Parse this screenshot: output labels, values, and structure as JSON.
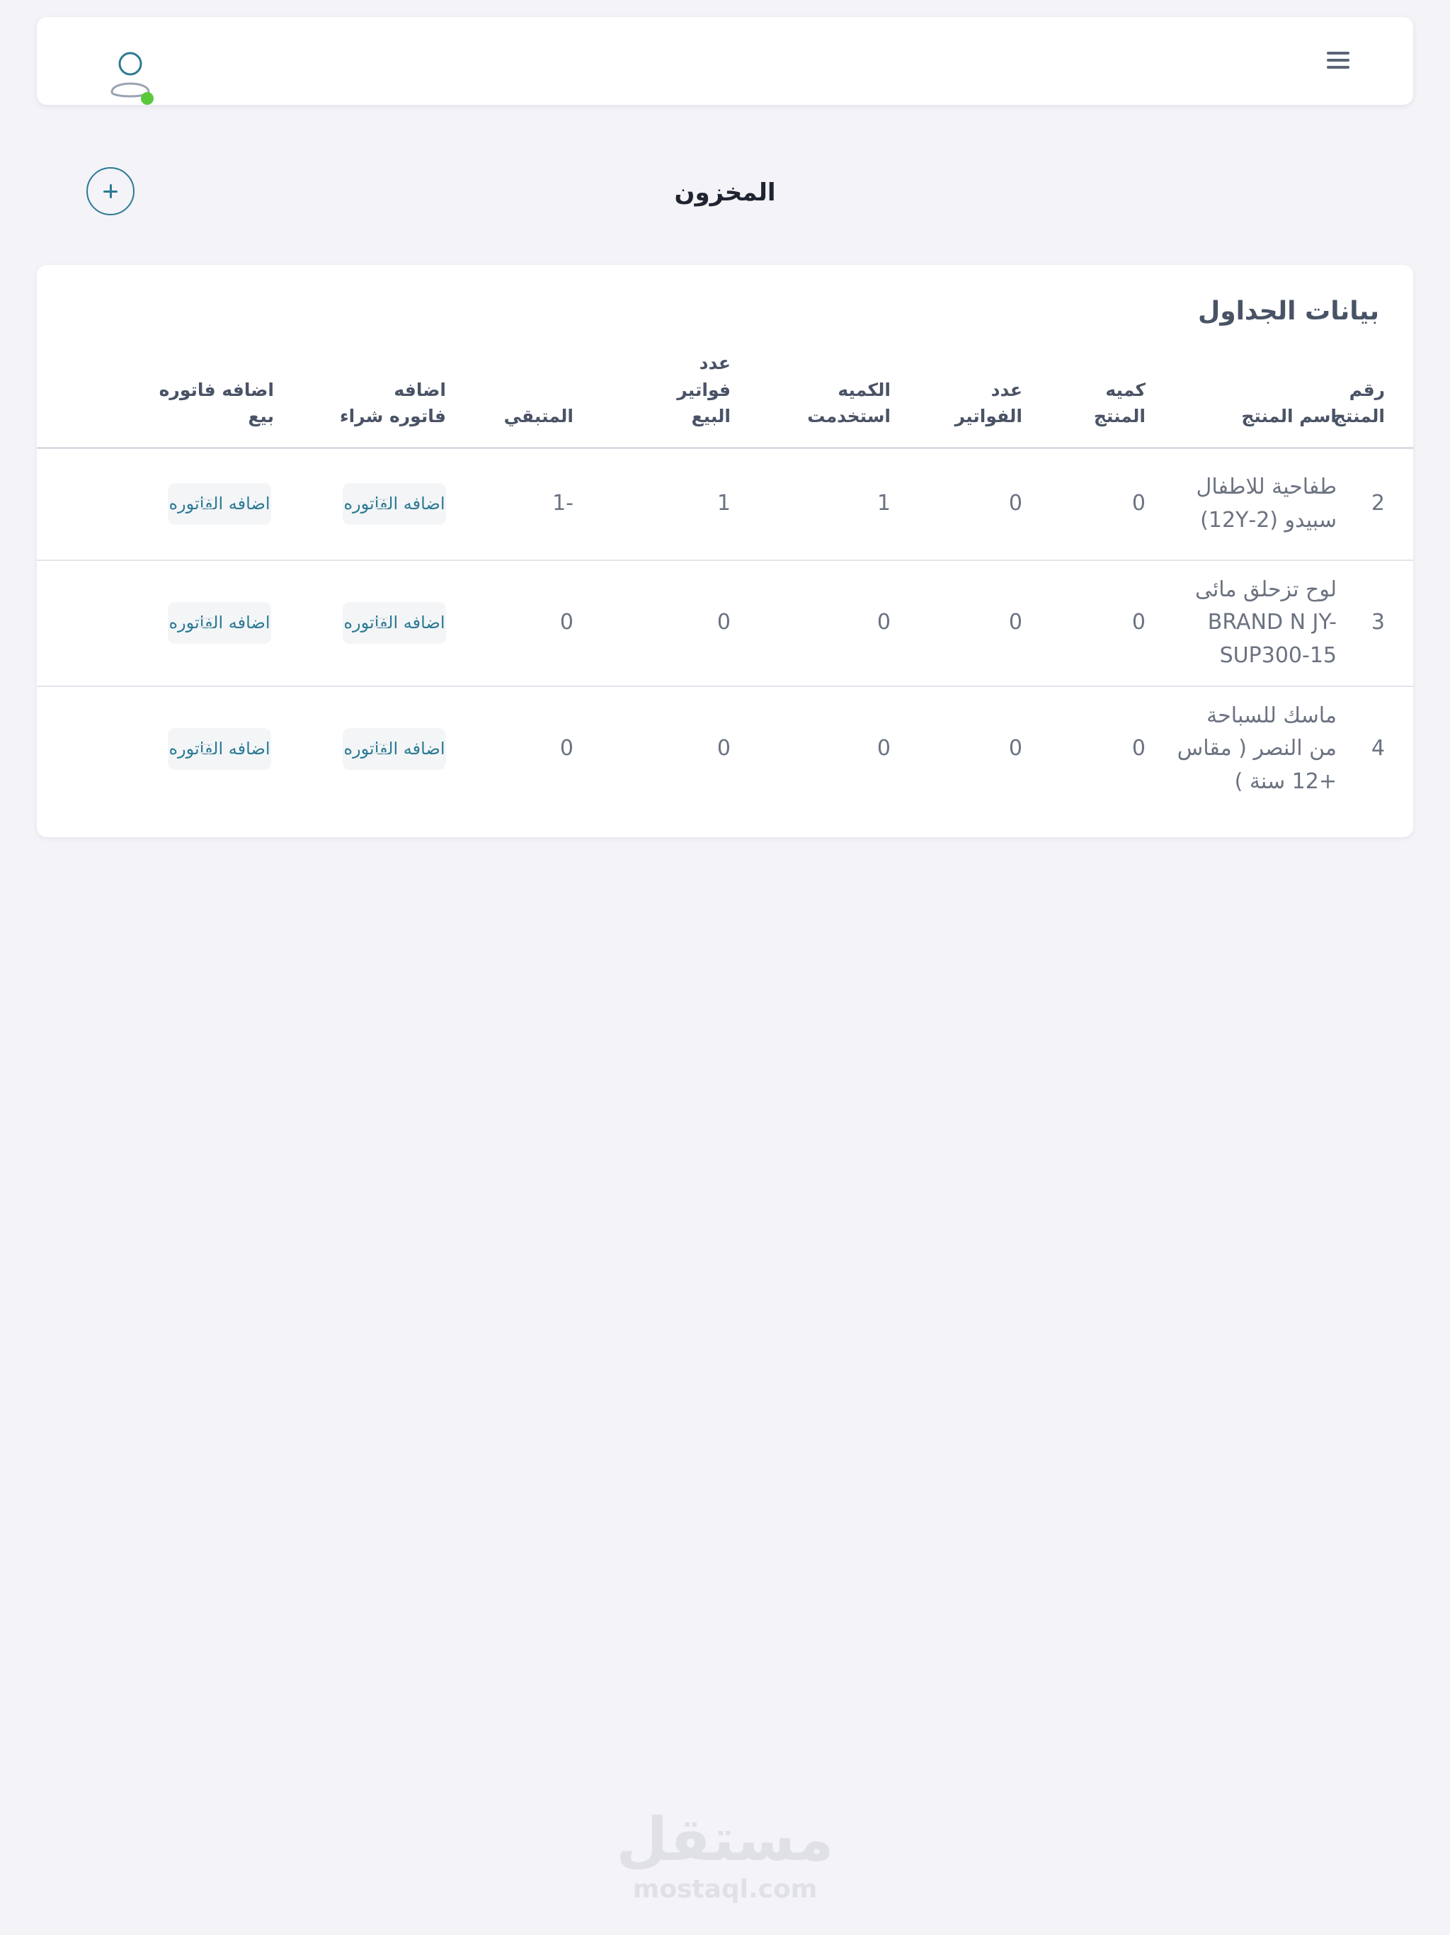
{
  "header": {
    "menu_icon": "hamburger-menu-icon",
    "avatar_icon": "user-avatar-icon",
    "online_status_color": "#5ac83c"
  },
  "page": {
    "title": "المخزون",
    "add_icon": "plus-icon"
  },
  "table_card": {
    "title": "بيانات الجداول",
    "columns": [
      "رقم المنتج",
      "اسم المنتج",
      "كميه المنتج",
      "عدد الفواتير",
      "الكميه استخدمت",
      "عدد فواتير البيع",
      "المتبقي",
      "اضافه فاتوره شراء",
      "اضافه فاتوره بيع"
    ],
    "rows": [
      {
        "id": "2",
        "name": "طفاحية للاطفال سبيدو (2-12Y)",
        "quantity": "0",
        "invoices": "0",
        "used": "1",
        "sale_invoices": "1",
        "remaining": "-1",
        "purchase_action": "اضافه الفاتوره",
        "sale_action": "اضافه الفاتوره"
      },
      {
        "id": "3",
        "name": "لوح تزحلق مائى BRAND N JY-SUP300-15",
        "quantity": "0",
        "invoices": "0",
        "used": "0",
        "sale_invoices": "0",
        "remaining": "0",
        "purchase_action": "اضافه الفاتوره",
        "sale_action": "اضافه الفاتوره"
      },
      {
        "id": "4",
        "name": "ماسك للسباحة من النصر ( مقاس +12 سنة )",
        "quantity": "0",
        "invoices": "0",
        "used": "0",
        "sale_invoices": "0",
        "remaining": "0",
        "purchase_action": "اضافه الفاتوره",
        "sale_action": "اضافه الفاتوره"
      }
    ]
  },
  "watermark": {
    "arabic": "مستقل",
    "latin": "mostaql.com"
  },
  "colors": {
    "accent": "#2c7a93",
    "background": "#f3f3f8",
    "card": "#ffffff"
  }
}
